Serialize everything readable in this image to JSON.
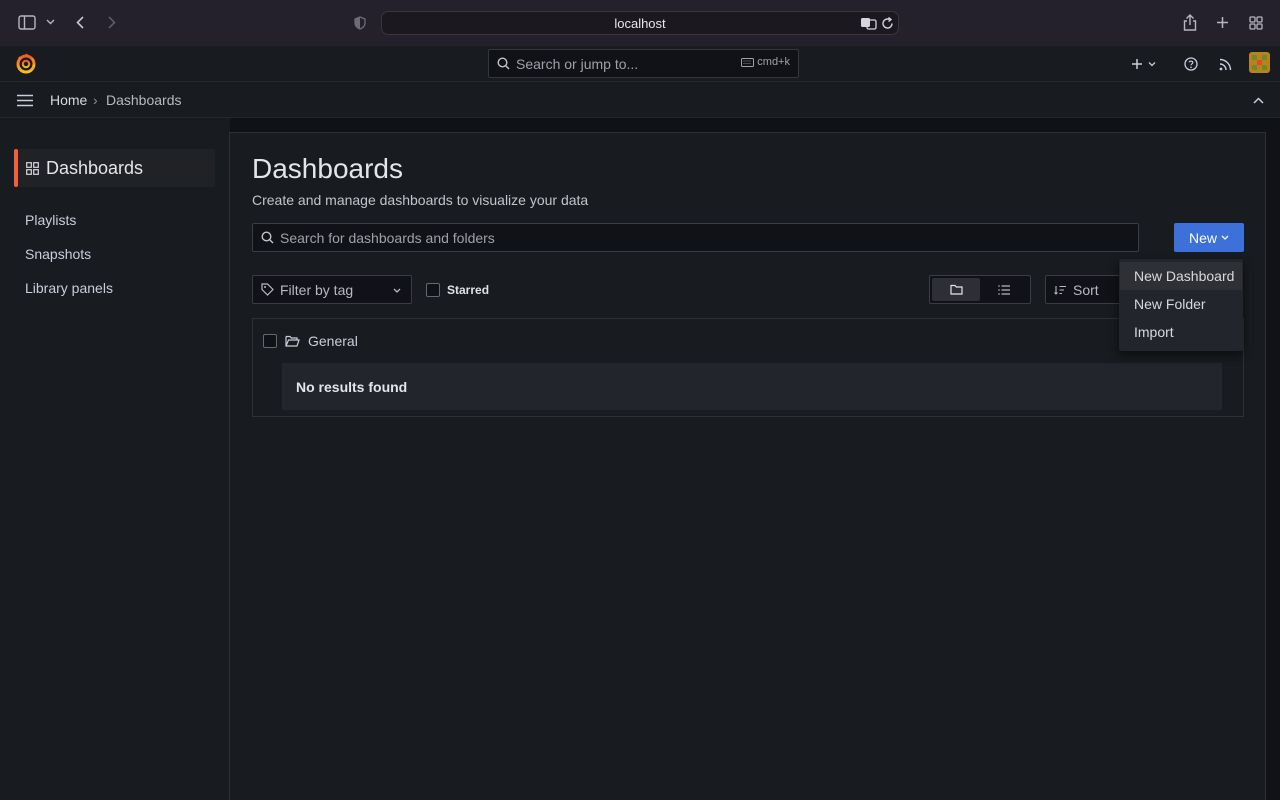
{
  "browser": {
    "url": "localhost"
  },
  "topnav": {
    "search_placeholder": "Search or jump to...",
    "shortcut": "cmd+k"
  },
  "breadcrumb": {
    "home": "Home",
    "separator": "›",
    "current": "Dashboards"
  },
  "sidebar": {
    "section_title": "Dashboards",
    "items": [
      {
        "label": "Playlists"
      },
      {
        "label": "Snapshots"
      },
      {
        "label": "Library panels"
      }
    ]
  },
  "main": {
    "title": "Dashboards",
    "subtitle": "Create and manage dashboards to visualize your data",
    "search_placeholder": "Search for dashboards and folders",
    "new_button": "New",
    "filter_placeholder": "Filter by tag",
    "starred_label": "Starred",
    "sort_label": "Sort",
    "folder_name": "General",
    "empty_message": "No results found"
  },
  "new_menu": {
    "items": [
      {
        "label": "New Dashboard"
      },
      {
        "label": "New Folder"
      },
      {
        "label": "Import"
      }
    ]
  },
  "colors": {
    "accent_orange": "#f55f3e",
    "primary_blue": "#3d71d9",
    "background": "#111217",
    "panel": "#181b1f"
  }
}
